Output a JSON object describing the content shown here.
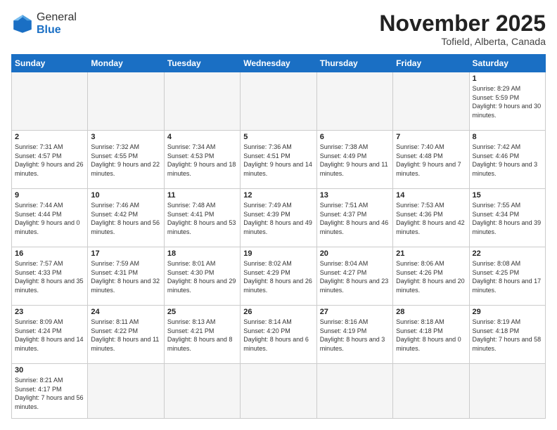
{
  "logo": {
    "general": "General",
    "blue": "Blue"
  },
  "title": "November 2025",
  "location": "Tofield, Alberta, Canada",
  "days_of_week": [
    "Sunday",
    "Monday",
    "Tuesday",
    "Wednesday",
    "Thursday",
    "Friday",
    "Saturday"
  ],
  "weeks": [
    [
      {
        "day": "",
        "info": ""
      },
      {
        "day": "",
        "info": ""
      },
      {
        "day": "",
        "info": ""
      },
      {
        "day": "",
        "info": ""
      },
      {
        "day": "",
        "info": ""
      },
      {
        "day": "",
        "info": ""
      },
      {
        "day": "1",
        "info": "Sunrise: 8:29 AM\nSunset: 5:59 PM\nDaylight: 9 hours\nand 30 minutes."
      }
    ],
    [
      {
        "day": "2",
        "info": "Sunrise: 7:31 AM\nSunset: 4:57 PM\nDaylight: 9 hours\nand 26 minutes."
      },
      {
        "day": "3",
        "info": "Sunrise: 7:32 AM\nSunset: 4:55 PM\nDaylight: 9 hours\nand 22 minutes."
      },
      {
        "day": "4",
        "info": "Sunrise: 7:34 AM\nSunset: 4:53 PM\nDaylight: 9 hours\nand 18 minutes."
      },
      {
        "day": "5",
        "info": "Sunrise: 7:36 AM\nSunset: 4:51 PM\nDaylight: 9 hours\nand 14 minutes."
      },
      {
        "day": "6",
        "info": "Sunrise: 7:38 AM\nSunset: 4:49 PM\nDaylight: 9 hours\nand 11 minutes."
      },
      {
        "day": "7",
        "info": "Sunrise: 7:40 AM\nSunset: 4:48 PM\nDaylight: 9 hours\nand 7 minutes."
      },
      {
        "day": "8",
        "info": "Sunrise: 7:42 AM\nSunset: 4:46 PM\nDaylight: 9 hours\nand 3 minutes."
      }
    ],
    [
      {
        "day": "9",
        "info": "Sunrise: 7:44 AM\nSunset: 4:44 PM\nDaylight: 9 hours\nand 0 minutes."
      },
      {
        "day": "10",
        "info": "Sunrise: 7:46 AM\nSunset: 4:42 PM\nDaylight: 8 hours\nand 56 minutes."
      },
      {
        "day": "11",
        "info": "Sunrise: 7:48 AM\nSunset: 4:41 PM\nDaylight: 8 hours\nand 53 minutes."
      },
      {
        "day": "12",
        "info": "Sunrise: 7:49 AM\nSunset: 4:39 PM\nDaylight: 8 hours\nand 49 minutes."
      },
      {
        "day": "13",
        "info": "Sunrise: 7:51 AM\nSunset: 4:37 PM\nDaylight: 8 hours\nand 46 minutes."
      },
      {
        "day": "14",
        "info": "Sunrise: 7:53 AM\nSunset: 4:36 PM\nDaylight: 8 hours\nand 42 minutes."
      },
      {
        "day": "15",
        "info": "Sunrise: 7:55 AM\nSunset: 4:34 PM\nDaylight: 8 hours\nand 39 minutes."
      }
    ],
    [
      {
        "day": "16",
        "info": "Sunrise: 7:57 AM\nSunset: 4:33 PM\nDaylight: 8 hours\nand 35 minutes."
      },
      {
        "day": "17",
        "info": "Sunrise: 7:59 AM\nSunset: 4:31 PM\nDaylight: 8 hours\nand 32 minutes."
      },
      {
        "day": "18",
        "info": "Sunrise: 8:01 AM\nSunset: 4:30 PM\nDaylight: 8 hours\nand 29 minutes."
      },
      {
        "day": "19",
        "info": "Sunrise: 8:02 AM\nSunset: 4:29 PM\nDaylight: 8 hours\nand 26 minutes."
      },
      {
        "day": "20",
        "info": "Sunrise: 8:04 AM\nSunset: 4:27 PM\nDaylight: 8 hours\nand 23 minutes."
      },
      {
        "day": "21",
        "info": "Sunrise: 8:06 AM\nSunset: 4:26 PM\nDaylight: 8 hours\nand 20 minutes."
      },
      {
        "day": "22",
        "info": "Sunrise: 8:08 AM\nSunset: 4:25 PM\nDaylight: 8 hours\nand 17 minutes."
      }
    ],
    [
      {
        "day": "23",
        "info": "Sunrise: 8:09 AM\nSunset: 4:24 PM\nDaylight: 8 hours\nand 14 minutes."
      },
      {
        "day": "24",
        "info": "Sunrise: 8:11 AM\nSunset: 4:22 PM\nDaylight: 8 hours\nand 11 minutes."
      },
      {
        "day": "25",
        "info": "Sunrise: 8:13 AM\nSunset: 4:21 PM\nDaylight: 8 hours\nand 8 minutes."
      },
      {
        "day": "26",
        "info": "Sunrise: 8:14 AM\nSunset: 4:20 PM\nDaylight: 8 hours\nand 6 minutes."
      },
      {
        "day": "27",
        "info": "Sunrise: 8:16 AM\nSunset: 4:19 PM\nDaylight: 8 hours\nand 3 minutes."
      },
      {
        "day": "28",
        "info": "Sunrise: 8:18 AM\nSunset: 4:18 PM\nDaylight: 8 hours\nand 0 minutes."
      },
      {
        "day": "29",
        "info": "Sunrise: 8:19 AM\nSunset: 4:18 PM\nDaylight: 7 hours\nand 58 minutes."
      }
    ],
    [
      {
        "day": "30",
        "info": "Sunrise: 8:21 AM\nSunset: 4:17 PM\nDaylight: 7 hours\nand 56 minutes."
      },
      {
        "day": "",
        "info": ""
      },
      {
        "day": "",
        "info": ""
      },
      {
        "day": "",
        "info": ""
      },
      {
        "day": "",
        "info": ""
      },
      {
        "day": "",
        "info": ""
      },
      {
        "day": "",
        "info": ""
      }
    ]
  ]
}
